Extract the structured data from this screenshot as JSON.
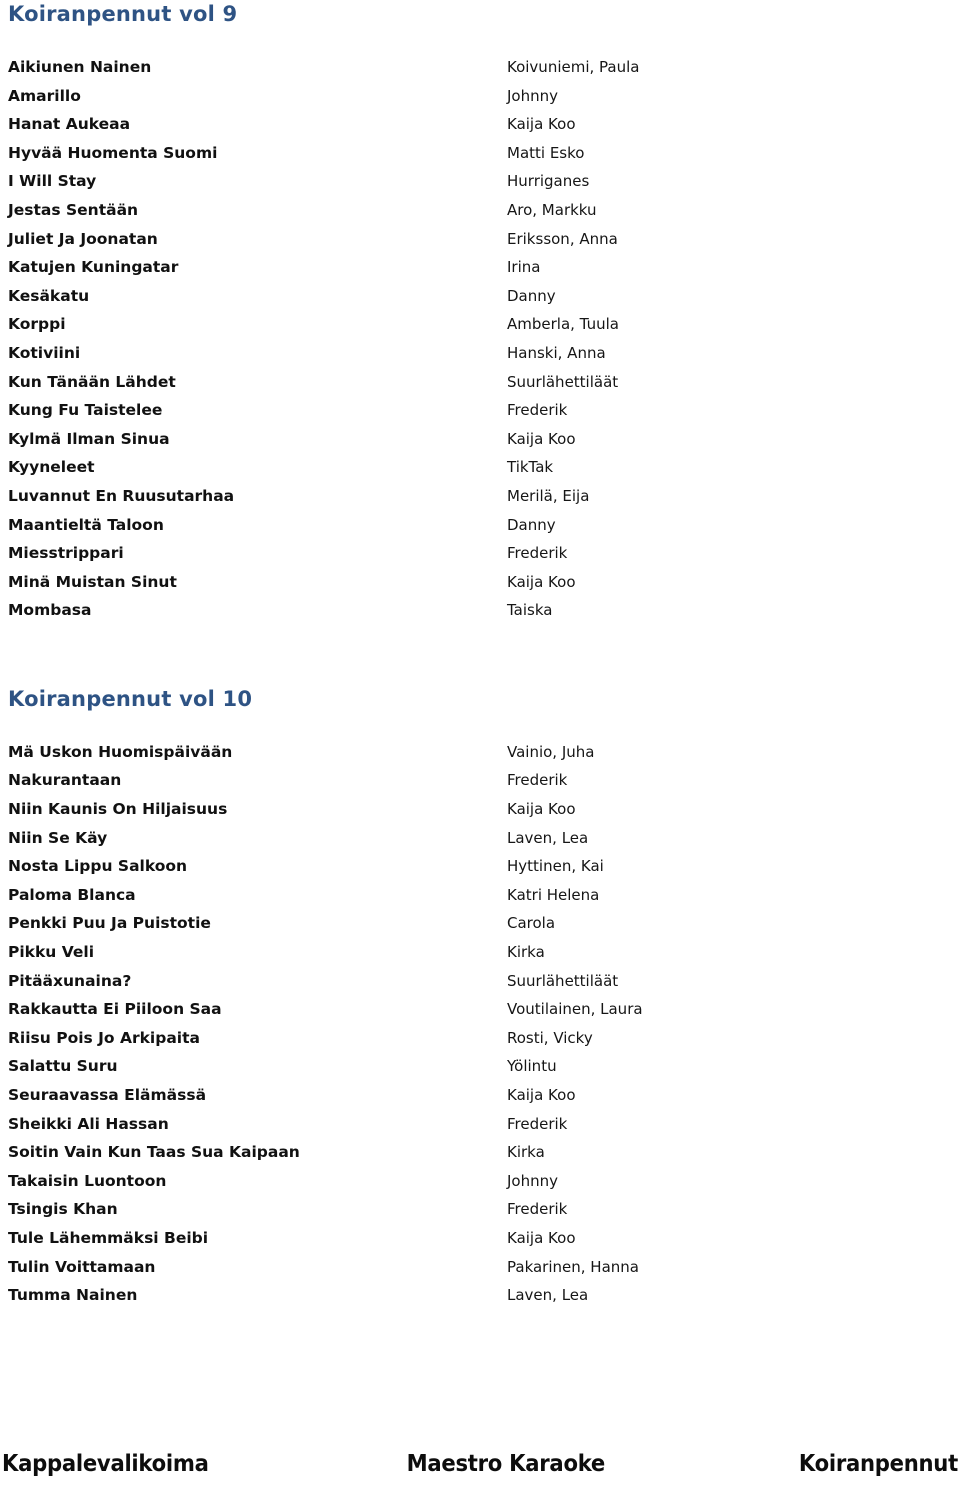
{
  "document": {
    "background_color": "#ffffff",
    "heading_color": "#2e5384",
    "text_color": "#111111"
  },
  "sections": [
    {
      "title": "Koiranpennut vol 9",
      "tracks": [
        {
          "title": "Aikiunen Nainen",
          "artist": "Koivuniemi, Paula"
        },
        {
          "title": "Amarillo",
          "artist": "Johnny"
        },
        {
          "title": "Hanat Aukeaa",
          "artist": "Kaija Koo"
        },
        {
          "title": "Hyvää Huomenta Suomi",
          "artist": "Matti Esko"
        },
        {
          "title": "I Will Stay",
          "artist": "Hurriganes"
        },
        {
          "title": "Jestas Sentään",
          "artist": "Aro, Markku"
        },
        {
          "title": "Juliet Ja Joonatan",
          "artist": "Eriksson, Anna"
        },
        {
          "title": "Katujen Kuningatar",
          "artist": "Irina"
        },
        {
          "title": "Kesäkatu",
          "artist": "Danny"
        },
        {
          "title": "Korppi",
          "artist": "Amberla, Tuula"
        },
        {
          "title": "Kotiviini",
          "artist": "Hanski, Anna"
        },
        {
          "title": "Kun Tänään Lähdet",
          "artist": "Suurlähettiläät"
        },
        {
          "title": "Kung Fu Taistelee",
          "artist": "Frederik"
        },
        {
          "title": "Kylmä Ilman Sinua",
          "artist": "Kaija Koo"
        },
        {
          "title": "Kyyneleet",
          "artist": "TikTak"
        },
        {
          "title": "Luvannut En Ruusutarhaa",
          "artist": "Merilä, Eija"
        },
        {
          "title": "Maantieltä Taloon",
          "artist": "Danny"
        },
        {
          "title": "Miesstrippari",
          "artist": "Frederik"
        },
        {
          "title": "Minä Muistan Sinut",
          "artist": "Kaija Koo"
        },
        {
          "title": "Mombasa",
          "artist": "Taiska"
        }
      ]
    },
    {
      "title": "Koiranpennut vol 10",
      "tracks": [
        {
          "title": "Mä Uskon Huomispäivään",
          "artist": "Vainio, Juha"
        },
        {
          "title": "Nakurantaan",
          "artist": "Frederik"
        },
        {
          "title": "Niin Kaunis On Hiljaisuus",
          "artist": "Kaija Koo"
        },
        {
          "title": "Niin Se Käy",
          "artist": "Laven, Lea"
        },
        {
          "title": "Nosta Lippu Salkoon",
          "artist": "Hyttinen, Kai"
        },
        {
          "title": "Paloma Blanca",
          "artist": "Katri Helena"
        },
        {
          "title": "Penkki Puu Ja Puistotie",
          "artist": "Carola"
        },
        {
          "title": "Pikku Veli",
          "artist": "Kirka"
        },
        {
          "title": "Pitääxunaina?",
          "artist": "Suurlähettiläät"
        },
        {
          "title": "Rakkautta Ei Piiloon Saa",
          "artist": "Voutilainen, Laura"
        },
        {
          "title": "Riisu Pois Jo Arkipaita",
          "artist": "Rosti, Vicky"
        },
        {
          "title": "Salattu Suru",
          "artist": "Yölintu"
        },
        {
          "title": "Seuraavassa Elämässä",
          "artist": "Kaija Koo"
        },
        {
          "title": "Sheikki Ali Hassan",
          "artist": "Frederik"
        },
        {
          "title": "Soitin Vain Kun Taas Sua Kaipaan",
          "artist": "Kirka"
        },
        {
          "title": "Takaisin Luontoon",
          "artist": "Johnny"
        },
        {
          "title": "Tsingis Khan",
          "artist": "Frederik"
        },
        {
          "title": "Tule Lähemmäksi Beibi",
          "artist": "Kaija Koo"
        },
        {
          "title": "Tulin Voittamaan",
          "artist": "Pakarinen, Hanna"
        },
        {
          "title": "Tumma Nainen",
          "artist": "Laven, Lea"
        }
      ]
    }
  ],
  "footer": {
    "left": "Kappalevalikoima",
    "center": "Maestro Karaoke",
    "right": "Koiranpennut"
  }
}
